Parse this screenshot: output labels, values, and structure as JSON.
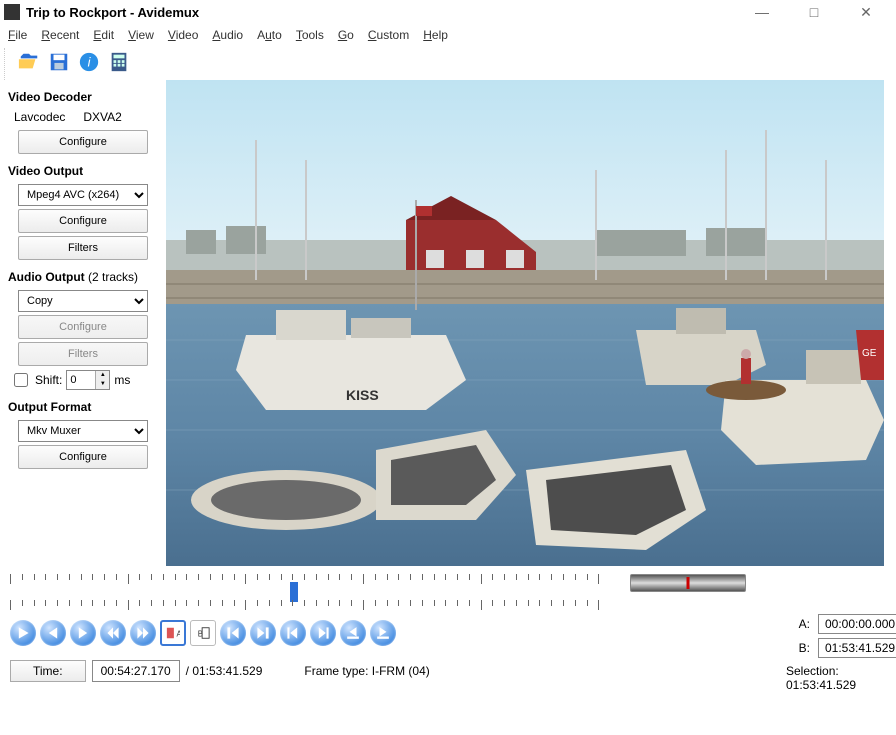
{
  "title": "Trip to Rockport - Avidemux",
  "menu": {
    "file": "File",
    "recent": "Recent",
    "edit": "Edit",
    "view": "View",
    "video": "Video",
    "audio": "Audio",
    "auto": "Auto",
    "tools": "Tools",
    "go": "Go",
    "custom": "Custom",
    "help": "Help"
  },
  "left": {
    "decoder_title": "Video Decoder",
    "decoder_a": "Lavcodec",
    "decoder_b": "DXVA2",
    "configure": "Configure",
    "video_output_title": "Video Output",
    "video_codec": "Mpeg4 AVC (x264)",
    "filters": "Filters",
    "audio_output_title": "Audio Output",
    "audio_tracks": "(2 tracks)",
    "audio_mode": "Copy",
    "shift_label": "Shift:",
    "shift_value": "0",
    "shift_unit": "ms",
    "format_title": "Output Format",
    "muxer": "Mkv Muxer"
  },
  "playback": {
    "time_label": "Time:",
    "current": "00:54:27.170",
    "total": "01:53:41.529",
    "frame_type_label": "Frame type:",
    "frame_type": "I-FRM (04)",
    "a_label": "A:",
    "a_value": "00:00:00.000",
    "b_label": "B:",
    "b_value": "01:53:41.529",
    "selection_label": "Selection:",
    "selection_value": "01:53:41.529"
  }
}
